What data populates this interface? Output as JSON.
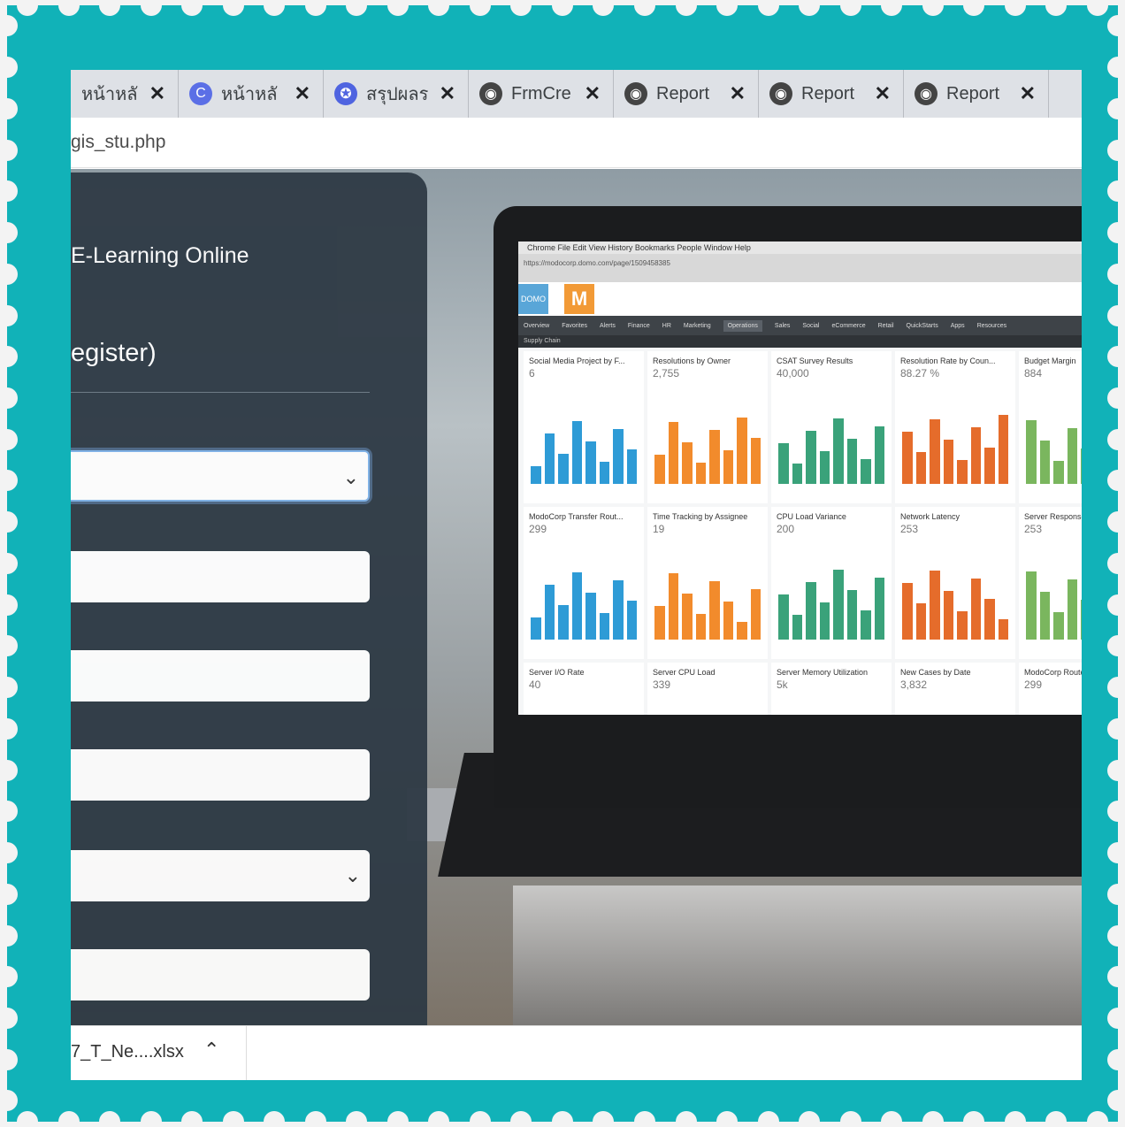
{
  "tabs": [
    {
      "label": "หน้าหลั",
      "icon": "blank-page-icon",
      "icon_color": "#dee1e6"
    },
    {
      "label": "หน้าหลั",
      "icon": "c-logo-icon",
      "icon_color": "#5b6fe6"
    },
    {
      "label": "สรุปผลร",
      "icon": "badge-icon",
      "icon_color": "#4f64e0"
    },
    {
      "label": "FrmCre",
      "icon": "globe-icon",
      "icon_color": "#444"
    },
    {
      "label": "Report",
      "icon": "globe-icon",
      "icon_color": "#444"
    },
    {
      "label": "Report",
      "icon": "globe-icon",
      "icon_color": "#444"
    },
    {
      "label": "Report",
      "icon": "globe-icon",
      "icon_color": "#444"
    }
  ],
  "address": {
    "url": "gis_stu.php"
  },
  "form": {
    "title": "E-Learning Online",
    "heading": "egister)"
  },
  "laptop": {
    "menubar": "Chrome   File   Edit   View   History   Bookmarks   People   Window   Help",
    "url": "https://modocorp.domo.com/page/1509458385",
    "logo_domo": "DOMO",
    "logo_m": "M",
    "nav": [
      "Overview",
      "Favorites",
      "Alerts",
      "Finance",
      "HR",
      "Marketing",
      "Operations",
      "Sales",
      "Social",
      "eCommerce",
      "Retail",
      "QuickStarts",
      "Apps",
      "Resources"
    ],
    "nav_active": "Operations",
    "sub": "Supply Chain",
    "cards": [
      {
        "title": "Social Media Project by F...",
        "value": "6"
      },
      {
        "title": "Resolutions by Owner",
        "value": "2,755"
      },
      {
        "title": "CSAT Survey Results",
        "value": "40,000"
      },
      {
        "title": "Resolution Rate by Coun...",
        "value": "88.27 %"
      },
      {
        "title": "Budget Margin",
        "value": "884"
      },
      {
        "title": "ModoCorp Transfer Rout...",
        "value": "299"
      },
      {
        "title": "Time Tracking by Assignee",
        "value": "19"
      },
      {
        "title": "CPU Load Variance",
        "value": "200"
      },
      {
        "title": "Network Latency",
        "value": "253"
      },
      {
        "title": "Server Response",
        "value": "253"
      },
      {
        "title": "Server I/O Rate",
        "value": "40"
      },
      {
        "title": "Server CPU Load",
        "value": "339"
      },
      {
        "title": "Server Memory Utilization",
        "value": "5k"
      },
      {
        "title": "New Cases by Date",
        "value": "3,832"
      },
      {
        "title": "ModoCorp Route",
        "value": "299"
      }
    ]
  },
  "download": {
    "file": "7_T_Ne....xlsx"
  },
  "colors": {
    "frame": "#11b2b8",
    "panel": "#2e3a45",
    "focus": "#7fb2e8"
  }
}
